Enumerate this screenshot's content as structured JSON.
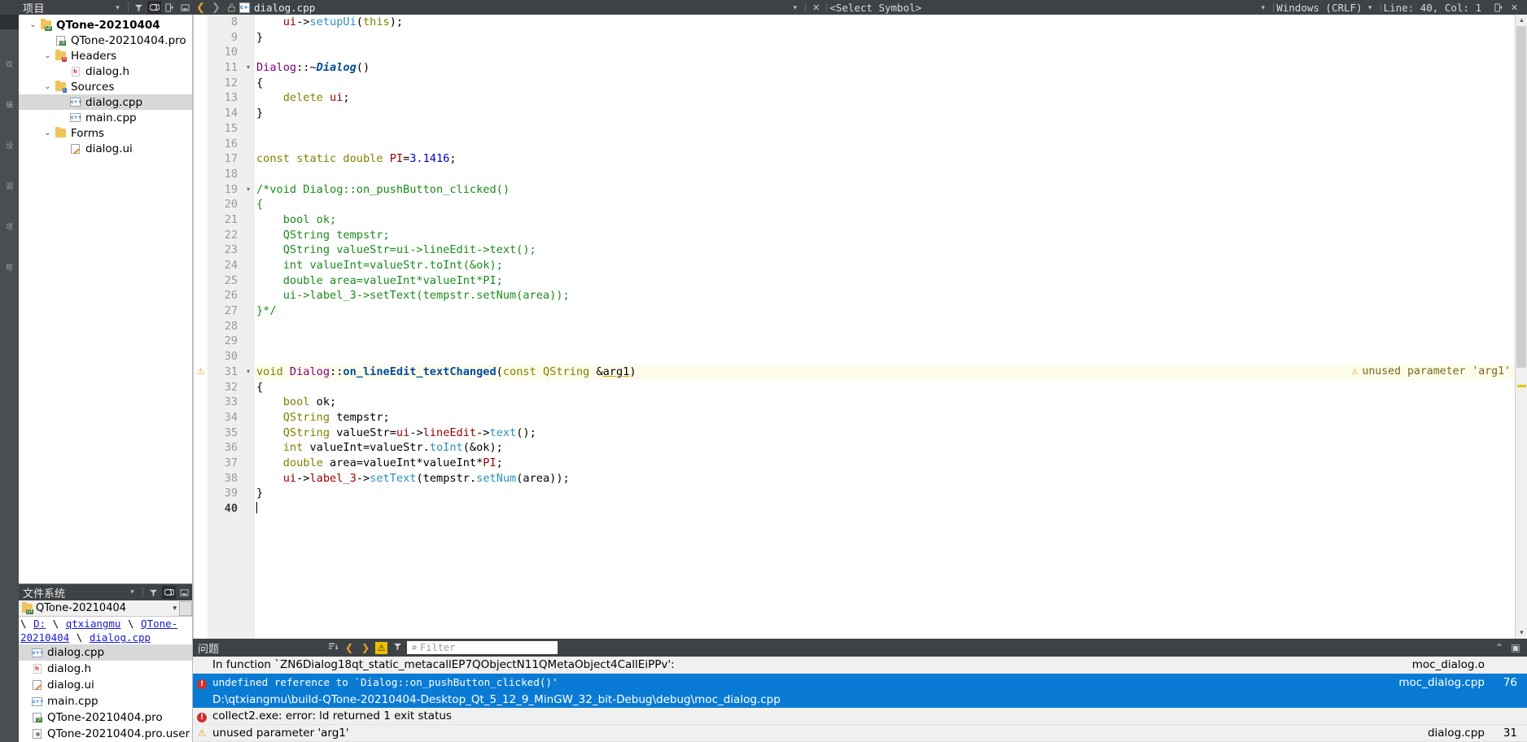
{
  "topbar": {
    "project_label": "项目",
    "filename": "dialog.cpp",
    "select_symbol": "<Select Symbol>",
    "line_ending": "Windows (CRLF)",
    "cursor_pos": "Line: 40, Col: 1",
    "icons": {
      "dropdown": "chevron-down-icon",
      "filter": "filter-icon",
      "link": "link-icon",
      "split": "split-icon",
      "minimize": "minimize-icon",
      "back": "back-arrow-icon",
      "forward": "forward-arrow-icon",
      "lock": "lock-icon",
      "close": "close-icon"
    }
  },
  "modestrip": {
    "items": [
      "欢",
      "编",
      "设",
      "调",
      "项",
      "帮"
    ]
  },
  "project_tree": [
    {
      "indent": 0,
      "twisty": "⌄",
      "icon": "folder-qt",
      "label": "QTone-20210404",
      "bold": true,
      "selected": false
    },
    {
      "indent": 1,
      "twisty": "",
      "icon": "pro",
      "label": "QTone-20210404.pro",
      "bold": false,
      "selected": false
    },
    {
      "indent": 1,
      "twisty": "⌄",
      "icon": "folder-h",
      "label": "Headers",
      "bold": false,
      "selected": false
    },
    {
      "indent": 2,
      "twisty": "",
      "icon": "h",
      "label": "dialog.h",
      "bold": false,
      "selected": false
    },
    {
      "indent": 1,
      "twisty": "⌄",
      "icon": "folder-c",
      "label": "Sources",
      "bold": false,
      "selected": false
    },
    {
      "indent": 2,
      "twisty": "",
      "icon": "cpp",
      "label": "dialog.cpp",
      "bold": false,
      "selected": true
    },
    {
      "indent": 2,
      "twisty": "",
      "icon": "cpp",
      "label": "main.cpp",
      "bold": false,
      "selected": false
    },
    {
      "indent": 1,
      "twisty": "⌄",
      "icon": "folder-ui",
      "label": "Forms",
      "bold": false,
      "selected": false
    },
    {
      "indent": 2,
      "twisty": "",
      "icon": "ui",
      "label": "dialog.ui",
      "bold": false,
      "selected": false
    }
  ],
  "filesystem": {
    "title": "文件系统",
    "combo_value": "QTone-20210404",
    "breadcrumb": [
      "D:",
      "qtxiangmu",
      "QTone-20210404",
      "dialog.cpp"
    ],
    "items": [
      {
        "icon": "cpp",
        "label": "dialog.cpp",
        "selected": true
      },
      {
        "icon": "h",
        "label": "dialog.h",
        "selected": false
      },
      {
        "icon": "ui",
        "label": "dialog.ui",
        "selected": false
      },
      {
        "icon": "cpp",
        "label": "main.cpp",
        "selected": false
      },
      {
        "icon": "pro",
        "label": "QTone-20210404.pro",
        "selected": false
      },
      {
        "icon": "user",
        "label": "QTone-20210404.pro.user",
        "selected": false
      }
    ]
  },
  "editor": {
    "first_line": 8,
    "current_line": 40,
    "inline_warning": "unused parameter 'arg1'",
    "lines": [
      {
        "n": 8,
        "fold": "",
        "mark": "",
        "green": false,
        "tokens": [
          {
            "t": "    ",
            "c": "op"
          },
          {
            "t": "ui",
            "c": "mem"
          },
          {
            "t": "->",
            "c": "op"
          },
          {
            "t": "setupUi",
            "c": "call"
          },
          {
            "t": "(",
            "c": "op"
          },
          {
            "t": "this",
            "c": "kw"
          },
          {
            "t": ");",
            "c": "op"
          }
        ]
      },
      {
        "n": 9,
        "fold": "",
        "mark": "",
        "green": false,
        "tokens": [
          {
            "t": "}",
            "c": "op"
          }
        ]
      },
      {
        "n": 10,
        "fold": "",
        "mark": "",
        "green": false,
        "tokens": []
      },
      {
        "n": 11,
        "fold": "▾",
        "mark": "",
        "green": false,
        "tokens": [
          {
            "t": "Dialog",
            "c": "cls"
          },
          {
            "t": "::~",
            "c": "op"
          },
          {
            "t": "Dialog",
            "c": "fnb"
          },
          {
            "t": "()",
            "c": "op"
          }
        ]
      },
      {
        "n": 12,
        "fold": "",
        "mark": "",
        "green": false,
        "tokens": [
          {
            "t": "{",
            "c": "op"
          }
        ]
      },
      {
        "n": 13,
        "fold": "",
        "mark": "",
        "green": false,
        "tokens": [
          {
            "t": "    ",
            "c": "op"
          },
          {
            "t": "delete",
            "c": "kw"
          },
          {
            "t": " ",
            "c": "op"
          },
          {
            "t": "ui",
            "c": "mem"
          },
          {
            "t": ";",
            "c": "op"
          }
        ]
      },
      {
        "n": 14,
        "fold": "",
        "mark": "",
        "green": false,
        "tokens": [
          {
            "t": "}",
            "c": "op"
          }
        ]
      },
      {
        "n": 15,
        "fold": "",
        "mark": "",
        "green": false,
        "tokens": []
      },
      {
        "n": 16,
        "fold": "",
        "mark": "",
        "green": true,
        "tokens": []
      },
      {
        "n": 17,
        "fold": "",
        "mark": "",
        "green": true,
        "tokens": [
          {
            "t": "const static double ",
            "c": "kw"
          },
          {
            "t": "PI",
            "c": "mem"
          },
          {
            "t": "=",
            "c": "op"
          },
          {
            "t": "3.1416",
            "c": "num2"
          },
          {
            "t": ";",
            "c": "op"
          }
        ]
      },
      {
        "n": 18,
        "fold": "",
        "mark": "",
        "green": true,
        "tokens": []
      },
      {
        "n": 19,
        "fold": "▾",
        "mark": "",
        "green": true,
        "tokens": [
          {
            "t": "/*void Dialog::on_pushButton_clicked()",
            "c": "cmt"
          }
        ]
      },
      {
        "n": 20,
        "fold": "",
        "mark": "",
        "green": true,
        "tokens": [
          {
            "t": "{",
            "c": "cmt"
          }
        ]
      },
      {
        "n": 21,
        "fold": "",
        "mark": "",
        "green": true,
        "tokens": [
          {
            "t": "    bool ok;",
            "c": "cmt"
          }
        ]
      },
      {
        "n": 22,
        "fold": "",
        "mark": "",
        "green": true,
        "tokens": [
          {
            "t": "    QString tempstr;",
            "c": "cmt"
          }
        ]
      },
      {
        "n": 23,
        "fold": "",
        "mark": "",
        "green": true,
        "tokens": [
          {
            "t": "    QString valueStr=ui->lineEdit->text();",
            "c": "cmt"
          }
        ]
      },
      {
        "n": 24,
        "fold": "",
        "mark": "",
        "green": true,
        "tokens": [
          {
            "t": "    int valueInt=valueStr.toInt(&ok);",
            "c": "cmt"
          }
        ]
      },
      {
        "n": 25,
        "fold": "",
        "mark": "",
        "green": true,
        "tokens": [
          {
            "t": "    double area=valueInt*valueInt*PI;",
            "c": "cmt"
          }
        ]
      },
      {
        "n": 26,
        "fold": "",
        "mark": "",
        "green": true,
        "tokens": [
          {
            "t": "    ui->label_3->setText(tempstr.setNum(area));",
            "c": "cmt"
          }
        ]
      },
      {
        "n": 27,
        "fold": "",
        "mark": "",
        "green": true,
        "tokens": [
          {
            "t": "}*/",
            "c": "cmt"
          }
        ]
      },
      {
        "n": 28,
        "fold": "",
        "mark": "",
        "green": true,
        "tokens": []
      },
      {
        "n": 29,
        "fold": "",
        "mark": "",
        "green": true,
        "tokens": []
      },
      {
        "n": 30,
        "fold": "",
        "mark": "",
        "green": true,
        "tokens": []
      },
      {
        "n": 31,
        "fold": "▾",
        "mark": "warn",
        "green": true,
        "warnline": true,
        "tokens": [
          {
            "t": "void ",
            "c": "kw"
          },
          {
            "t": "Dialog",
            "c": "cls"
          },
          {
            "t": "::",
            "c": "op"
          },
          {
            "t": "on_lineEdit_textChanged",
            "c": "fn"
          },
          {
            "t": "(",
            "c": "op"
          },
          {
            "t": "const ",
            "c": "kw"
          },
          {
            "t": "QString ",
            "c": "typ"
          },
          {
            "t": "&",
            "c": "op"
          },
          {
            "t": "arg1",
            "c": "err-underline"
          },
          {
            "t": ")",
            "c": "op"
          }
        ]
      },
      {
        "n": 32,
        "fold": "",
        "mark": "",
        "green": true,
        "tokens": [
          {
            "t": "{",
            "c": "op"
          }
        ]
      },
      {
        "n": 33,
        "fold": "",
        "mark": "",
        "green": true,
        "tokens": [
          {
            "t": "    ",
            "c": "op"
          },
          {
            "t": "bool",
            "c": "kw"
          },
          {
            "t": " ok;",
            "c": "op"
          }
        ]
      },
      {
        "n": 34,
        "fold": "",
        "mark": "",
        "green": true,
        "tokens": [
          {
            "t": "    ",
            "c": "op"
          },
          {
            "t": "QString",
            "c": "typ"
          },
          {
            "t": " tempstr;",
            "c": "op"
          }
        ]
      },
      {
        "n": 35,
        "fold": "",
        "mark": "",
        "green": true,
        "tokens": [
          {
            "t": "    ",
            "c": "op"
          },
          {
            "t": "QString",
            "c": "typ"
          },
          {
            "t": " valueStr=",
            "c": "op"
          },
          {
            "t": "ui",
            "c": "mem"
          },
          {
            "t": "->",
            "c": "op"
          },
          {
            "t": "lineEdit",
            "c": "mem"
          },
          {
            "t": "->",
            "c": "op"
          },
          {
            "t": "text",
            "c": "call"
          },
          {
            "t": "();",
            "c": "op"
          }
        ]
      },
      {
        "n": 36,
        "fold": "",
        "mark": "",
        "green": true,
        "tokens": [
          {
            "t": "    ",
            "c": "op"
          },
          {
            "t": "int",
            "c": "kw"
          },
          {
            "t": " valueInt=valueStr.",
            "c": "op"
          },
          {
            "t": "toInt",
            "c": "call"
          },
          {
            "t": "(&ok);",
            "c": "op"
          }
        ]
      },
      {
        "n": 37,
        "fold": "",
        "mark": "",
        "green": true,
        "tokens": [
          {
            "t": "    ",
            "c": "op"
          },
          {
            "t": "double",
            "c": "kw"
          },
          {
            "t": " area=valueInt*valueInt*",
            "c": "op"
          },
          {
            "t": "PI",
            "c": "mem"
          },
          {
            "t": ";",
            "c": "op"
          }
        ]
      },
      {
        "n": 38,
        "fold": "",
        "mark": "",
        "green": true,
        "tokens": [
          {
            "t": "    ",
            "c": "op"
          },
          {
            "t": "ui",
            "c": "mem"
          },
          {
            "t": "->",
            "c": "op"
          },
          {
            "t": "label_3",
            "c": "mem"
          },
          {
            "t": "->",
            "c": "op"
          },
          {
            "t": "setText",
            "c": "call"
          },
          {
            "t": "(tempstr.",
            "c": "op"
          },
          {
            "t": "setNum",
            "c": "call"
          },
          {
            "t": "(area));",
            "c": "op"
          }
        ]
      },
      {
        "n": 39,
        "fold": "",
        "mark": "",
        "green": true,
        "tokens": [
          {
            "t": "}",
            "c": "op"
          }
        ]
      },
      {
        "n": 40,
        "fold": "",
        "mark": "",
        "green": true,
        "caret": true,
        "tokens": []
      }
    ]
  },
  "issues": {
    "title": "问题",
    "filter_placeholder": "Filter",
    "rows": [
      {
        "icon": "none",
        "text": "In function `ZN6Dialog18qt_static_metacallEP7QObjectN11QMetaObject4CallEiPPv':",
        "file": "moc_dialog.o",
        "line": "",
        "selected": false,
        "mono": false
      },
      {
        "icon": "error",
        "text": "undefined reference to `Dialog::on_pushButton_clicked()'",
        "file": "moc_dialog.cpp",
        "line": "76",
        "selected": true,
        "mono": true
      },
      {
        "icon": "none",
        "text": "D:\\qtxiangmu\\build-QTone-20210404-Desktop_Qt_5_12_9_MinGW_32_bit-Debug\\debug\\moc_dialog.cpp",
        "file": "",
        "line": "",
        "selected": true,
        "mono": false
      },
      {
        "icon": "error",
        "text": "collect2.exe: error: ld returned 1 exit status",
        "file": "",
        "line": "",
        "selected": false,
        "mono": false
      },
      {
        "icon": "warn",
        "text": "unused parameter 'arg1'",
        "file": "dialog.cpp",
        "line": "31",
        "selected": false,
        "mono": false
      }
    ]
  },
  "colors": {
    "chrome": "#3e4245",
    "selection": "#0a7bd4",
    "error": "#d32f2f",
    "warning": "#e6a817",
    "comment": "#1a8b1a"
  }
}
